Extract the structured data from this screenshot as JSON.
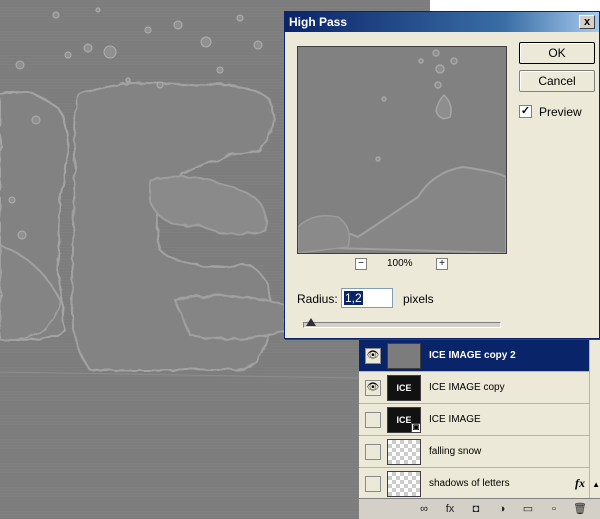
{
  "dialog": {
    "title": "High Pass",
    "close_glyph": "x",
    "ok_label": "OK",
    "cancel_label": "Cancel",
    "preview_label": "Preview",
    "preview_checked": true,
    "zoom_level": "100%",
    "zoom_out_glyph": "−",
    "zoom_in_glyph": "+",
    "radius_label": "Radius:",
    "radius_value": "1,2",
    "unit_label": "pixels",
    "slider_value_fraction": 0.04
  },
  "layers": {
    "items": [
      {
        "name": "ICE IMAGE copy 2",
        "visible": true,
        "selected": true,
        "thumb": "gray",
        "fx": ""
      },
      {
        "name": "ICE IMAGE copy",
        "visible": true,
        "selected": false,
        "thumb": "ice",
        "fx": ""
      },
      {
        "name": "ICE IMAGE",
        "visible": false,
        "selected": false,
        "thumb": "ice-smart",
        "fx": ""
      },
      {
        "name": "falling snow",
        "visible": false,
        "selected": false,
        "thumb": "checker",
        "fx": ""
      },
      {
        "name": "shadows of letters",
        "visible": false,
        "selected": false,
        "thumb": "checker",
        "fx": "fx"
      }
    ],
    "thumb_text": "ICE",
    "eye_glyph": "👁",
    "footer_icons": [
      "link-icon",
      "fx-icon",
      "mask-icon",
      "adjustment-icon",
      "folder-icon",
      "new-layer-icon",
      "trash-icon"
    ],
    "footer_glyphs": [
      "∞",
      "fx",
      "◘",
      "◑",
      "▭",
      "▫",
      "🗑"
    ]
  },
  "colors": {
    "selection": "#0a246a",
    "dialog_bg": "#ece9d8",
    "canvas": "#7d7d7d"
  }
}
